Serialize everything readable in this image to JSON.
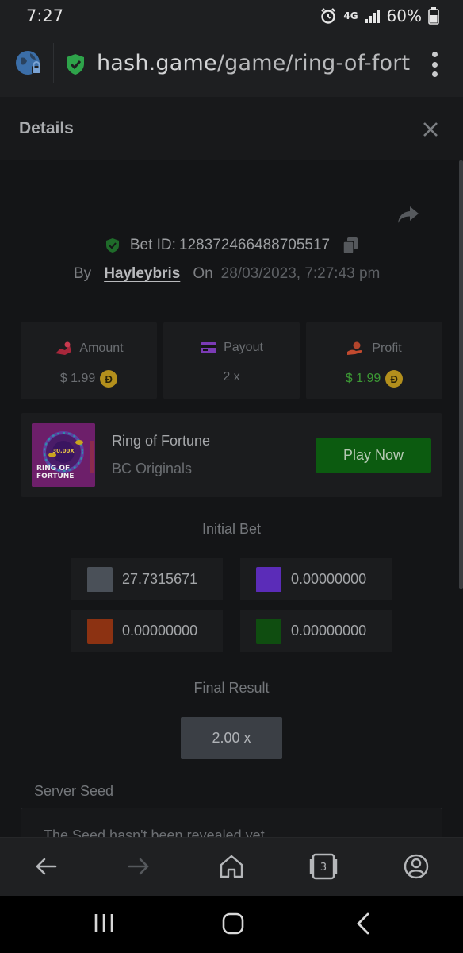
{
  "status_bar": {
    "time": "7:27",
    "network": "4G",
    "battery": "60%"
  },
  "browser": {
    "url_host": "hash.game",
    "url_path": "/game/ring-of-fortune"
  },
  "details": {
    "title": "Details",
    "bet_id_label": "Bet ID:",
    "bet_id": "128372466488705517",
    "by_label": "By",
    "user": "Hayleybris",
    "on_label": "On",
    "date": "28/03/2023, 7:27:43 pm"
  },
  "stats": [
    {
      "label": "Amount",
      "value": "$ 1.99",
      "coin": "Đ",
      "color": "#6b6e72"
    },
    {
      "label": "Payout",
      "value": "2 x",
      "coin": "",
      "color": "#6b6e72"
    },
    {
      "label": "Profit",
      "value": "$ 1.99",
      "coin": "Đ",
      "color": "#3d9a35"
    }
  ],
  "game": {
    "thumb_title_1": "RING OF",
    "thumb_title_2": "FORTUNE",
    "thumb_multiplier": "30.00X",
    "name": "Ring of Fortune",
    "provider": "BC Originals",
    "play_label": "Play Now"
  },
  "initial_bet": {
    "title": "Initial Bet",
    "cells": [
      {
        "value": "27.7315671",
        "color": "#4a5058"
      },
      {
        "value": "0.00000000",
        "color": "#5b2cb8"
      },
      {
        "value": "0.00000000",
        "color": "#8c3212"
      },
      {
        "value": "0.00000000",
        "color": "#0f4d10"
      }
    ]
  },
  "final_result": {
    "title": "Final Result",
    "value": "2.00 x"
  },
  "server_seed": {
    "label": "Server Seed",
    "text": "The Seed hasn't been revealed yet"
  },
  "bottom_nav": {
    "tab_count": "3"
  }
}
